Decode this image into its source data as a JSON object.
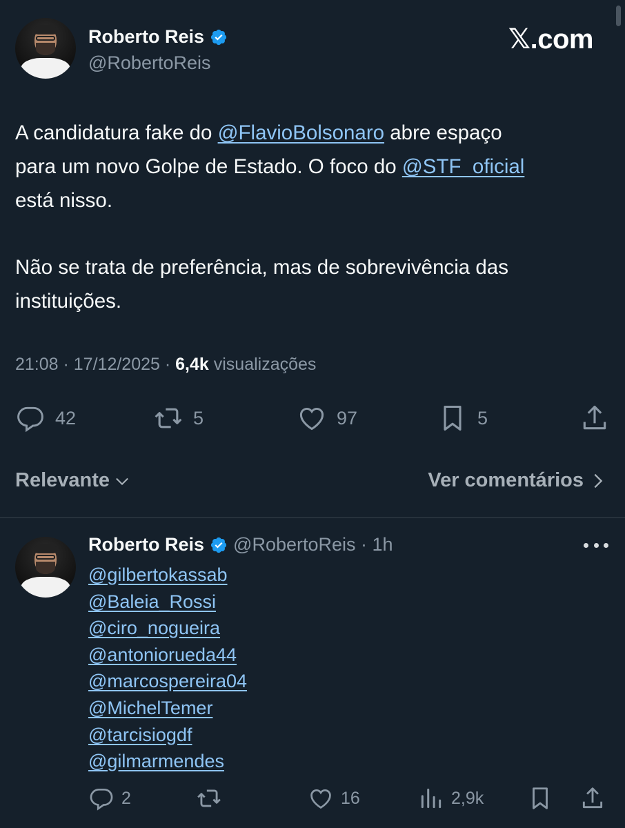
{
  "post": {
    "display_name": "Roberto Reis",
    "handle": "@RobertoReis",
    "brand": "X.com",
    "brand_x": "𝕏",
    "brand_rest": ".com",
    "text": {
      "line1_pre": "A candidatura fake do ",
      "mention1": "@FlavioBolsonaro",
      "line1_post": " abre espaço",
      "line2_pre": "para um novo Golpe de Estado. O foco do ",
      "mention2": "@STF_oficial",
      "line3": "está nisso.",
      "para2_line1": "Não se trata de preferência, mas de sobrevivência das",
      "para2_line2": "instituições."
    },
    "time": "21:08",
    "date": "17/12/2025",
    "views_count": "6,4k",
    "views_label": "visualizações",
    "replies": "42",
    "reposts": "5",
    "likes": "97",
    "bookmarks": "5"
  },
  "sort": {
    "label": "Relevante",
    "comments_link": "Ver comentários"
  },
  "reply": {
    "display_name": "Roberto Reis",
    "handle_time": "@RobertoReis · 1h",
    "mentions": [
      "@gilbertokassab",
      "@Baleia_Rossi",
      "@ciro_nogueira",
      "@antoniorueda44",
      "@marcospereira04",
      "@MichelTemer",
      "@tarcisiogdf",
      "@gilmarmendes"
    ],
    "replies": "2",
    "likes": "16",
    "views": "2,9k"
  },
  "colors": {
    "background": "#15202b",
    "verified": "#1d9bf0",
    "mention": "#8fc5f5",
    "secondary_text": "#8b98a5"
  }
}
